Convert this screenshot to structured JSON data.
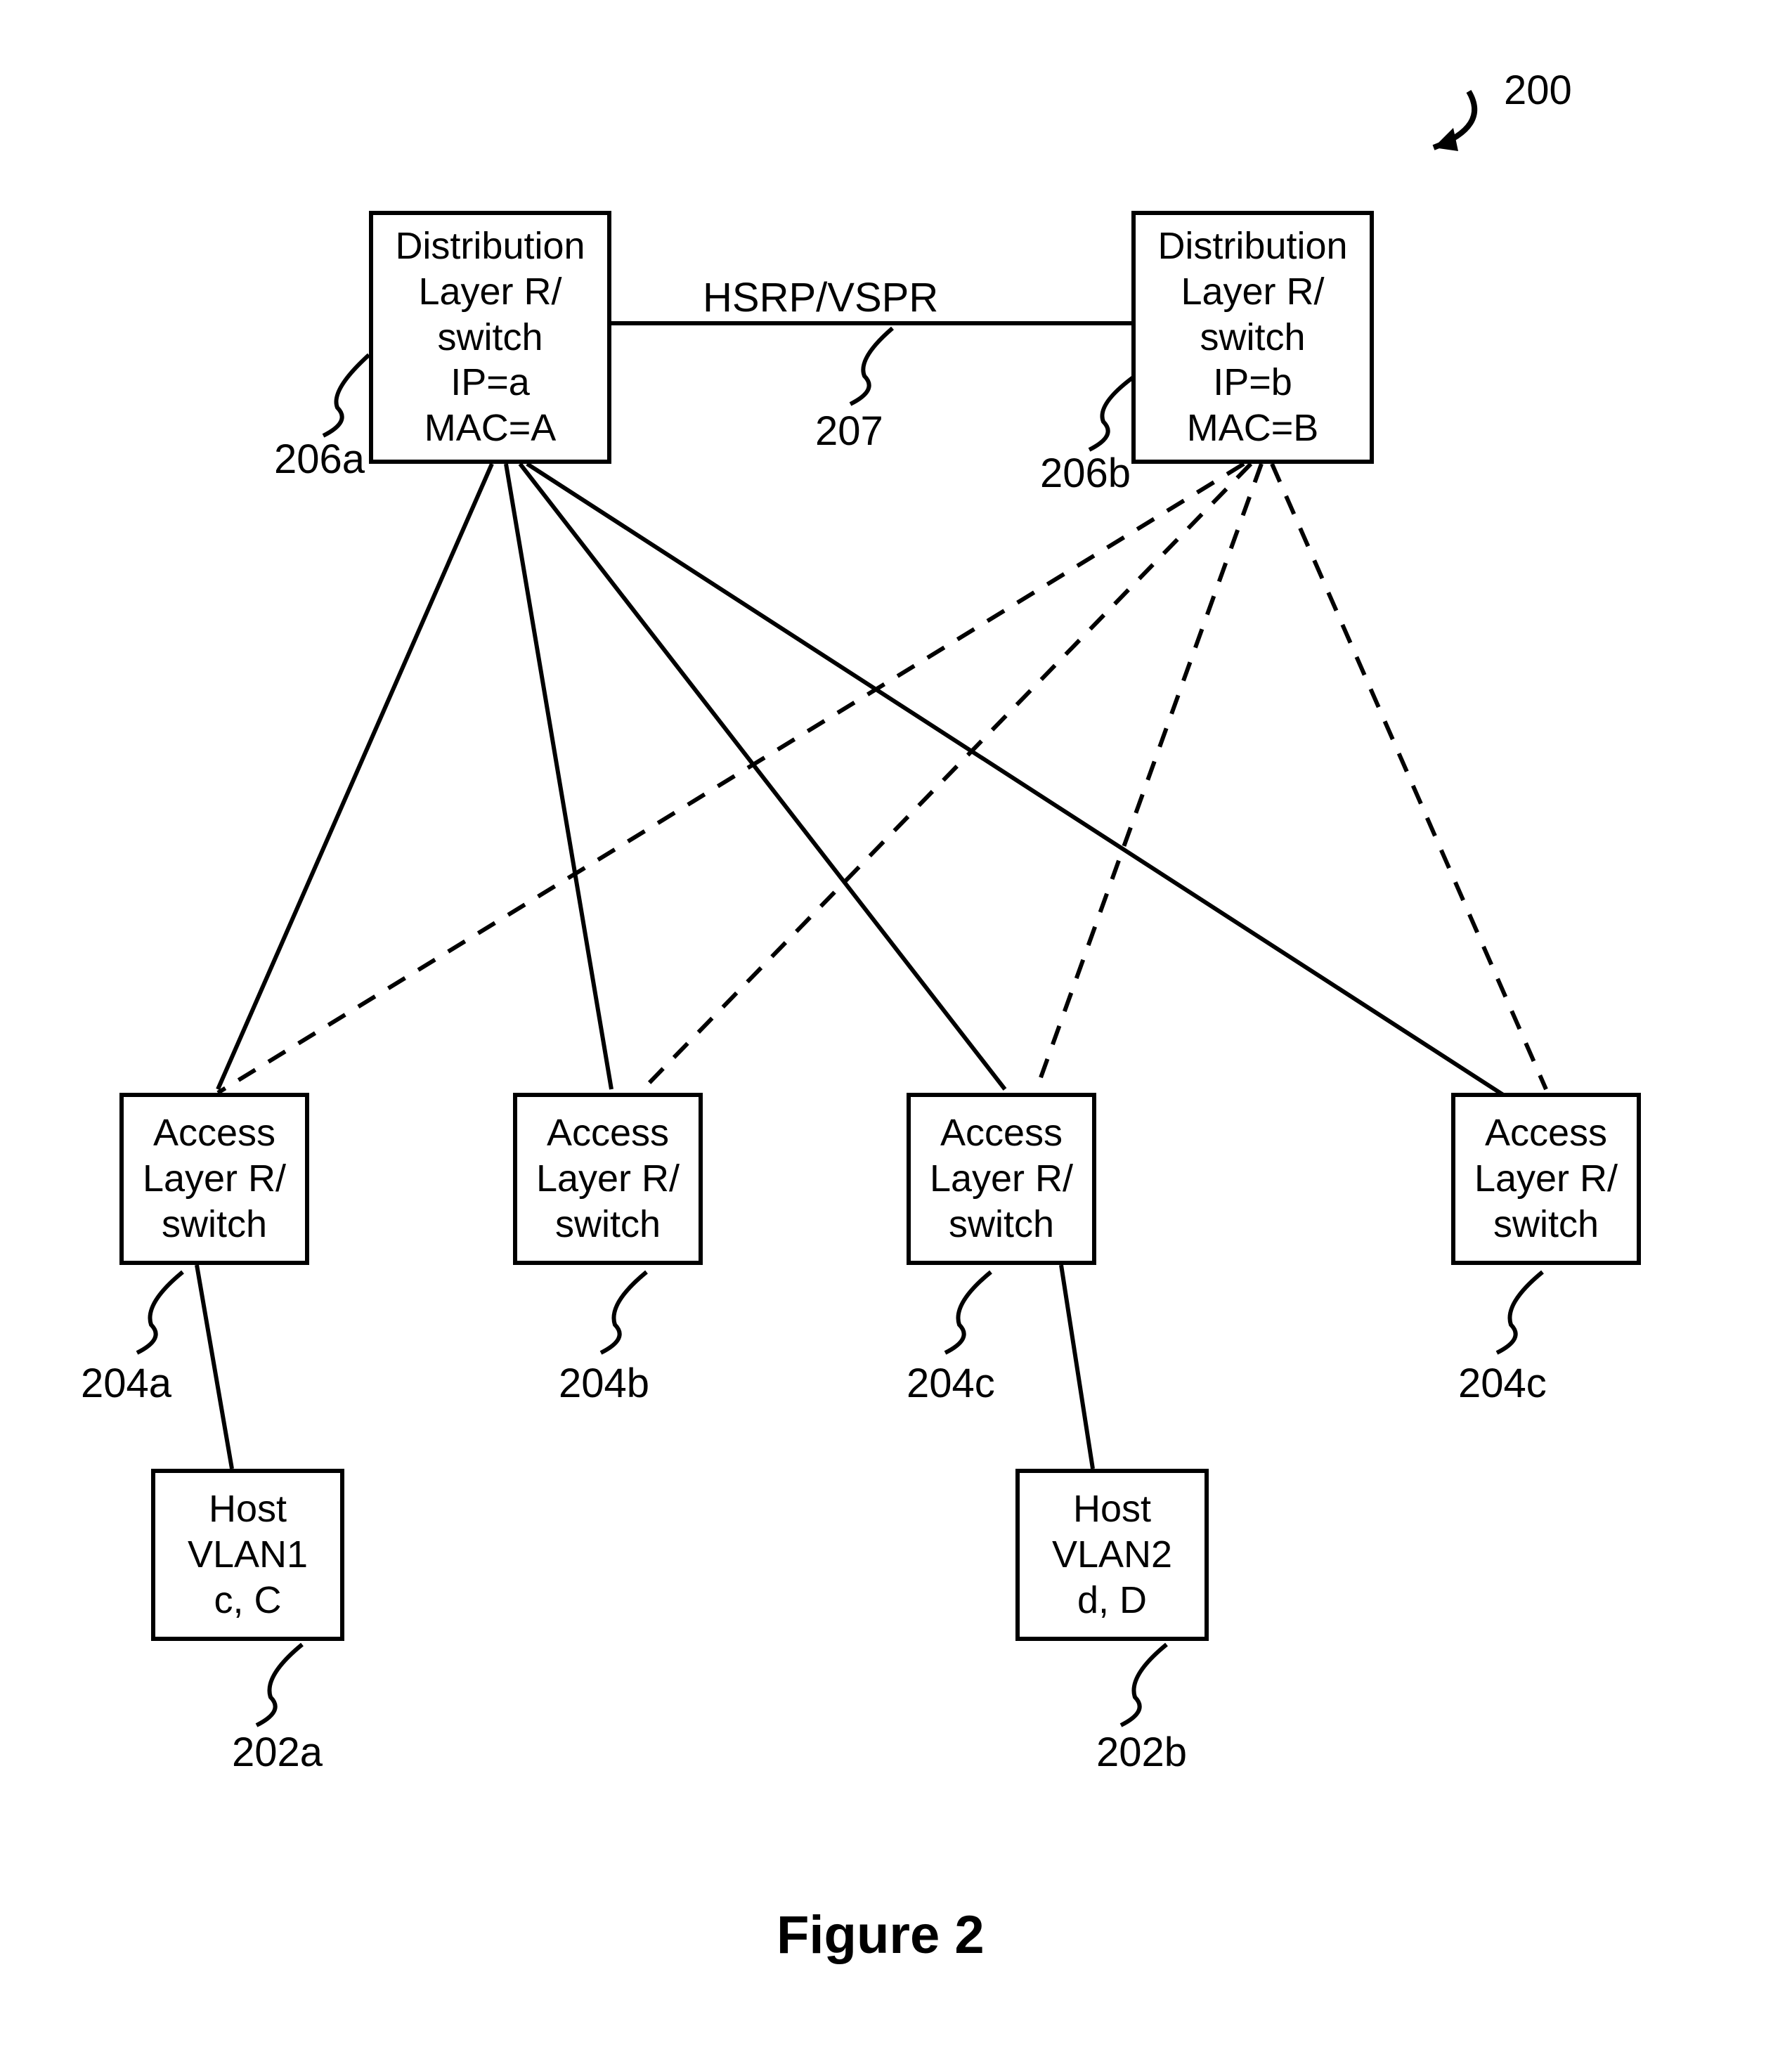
{
  "figureRef": {
    "arrowLabel": "200"
  },
  "nodes": {
    "distA": {
      "l1": "Distribution",
      "l2": "Layer R/",
      "l3": "switch",
      "l4": "IP=a",
      "l5": "MAC=A"
    },
    "distB": {
      "l1": "Distribution",
      "l2": "Layer R/",
      "l3": "switch",
      "l4": "IP=b",
      "l5": "MAC=B"
    },
    "access1": {
      "l1": "Access",
      "l2": "Layer R/",
      "l3": "switch"
    },
    "access2": {
      "l1": "Access",
      "l2": "Layer R/",
      "l3": "switch"
    },
    "access3": {
      "l1": "Access",
      "l2": "Layer R/",
      "l3": "switch"
    },
    "access4": {
      "l1": "Access",
      "l2": "Layer R/",
      "l3": "switch"
    },
    "host1": {
      "l1": "Host",
      "l2": "VLAN1",
      "l3": "c, C"
    },
    "host2": {
      "l1": "Host",
      "l2": "VLAN2",
      "l3": "d, D"
    }
  },
  "linkLabel": "HSRP/VSPR",
  "callouts": {
    "distA": "206a",
    "distB": "206b",
    "link": "207",
    "access1": "204a",
    "access2": "204b",
    "access3": "204c",
    "access4": "204c",
    "host1": "202a",
    "host2": "202b"
  },
  "caption": "Figure 2"
}
